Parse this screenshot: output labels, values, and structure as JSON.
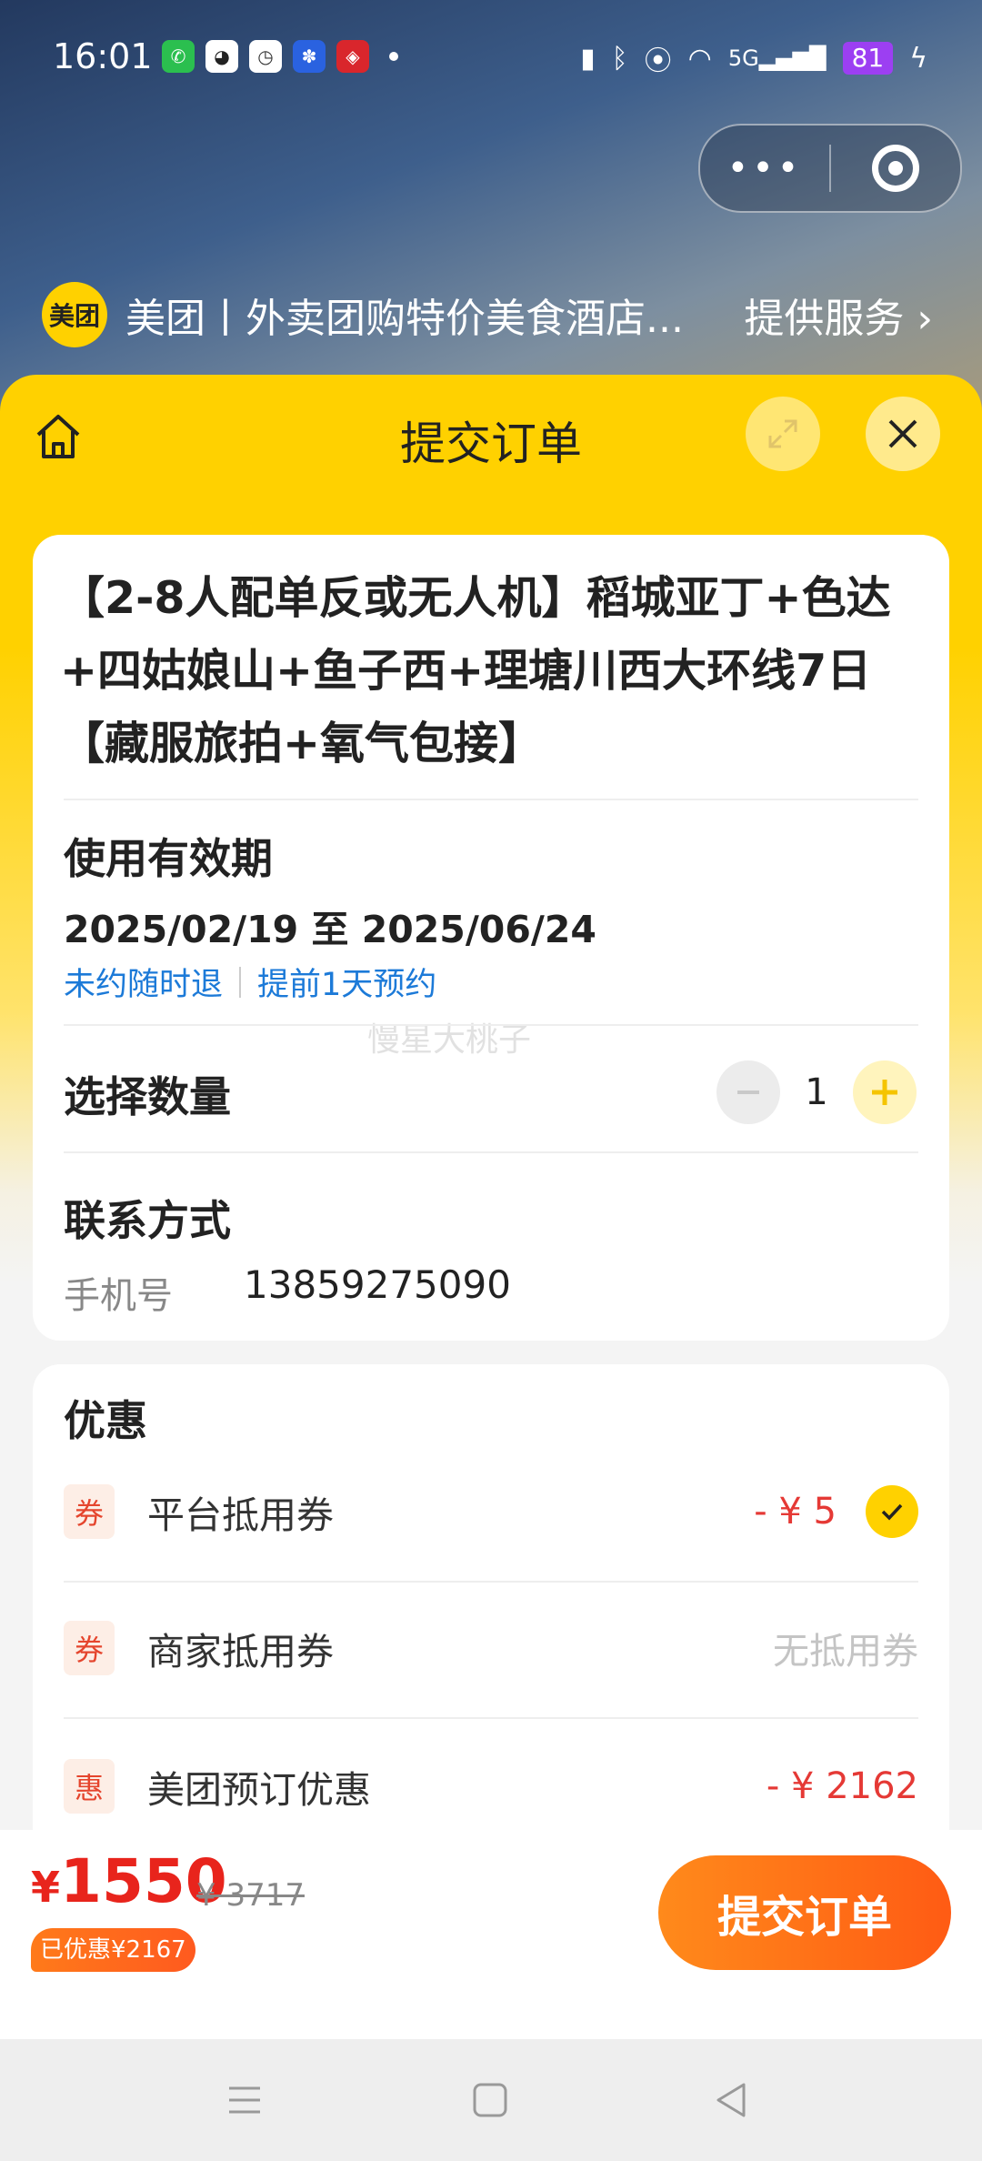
{
  "status_bar": {
    "time": "16:01",
    "battery": "81",
    "network": "5G"
  },
  "mini_program": {
    "logo_text": "美团",
    "name": "美团丨外卖团购特价美食酒店...",
    "service": "提供服务"
  },
  "header": {
    "title": "提交订单"
  },
  "product": {
    "title": "【2-8人配单反或无人机】稻城亚丁+色达+四姑娘山+鱼子西+理塘川西大环线7日【藏服旅拍+氧气包接】"
  },
  "validity": {
    "label": "使用有效期",
    "dates": "2025/02/19 至 2025/06/24",
    "tags": [
      "未约随时退",
      "提前1天预约"
    ]
  },
  "watermark": "慢星大桃子",
  "quantity": {
    "label": "选择数量",
    "value": "1"
  },
  "contact": {
    "label": "联系方式",
    "phone_label": "手机号",
    "phone": "13859275090"
  },
  "discounts": {
    "title": "优惠",
    "items": [
      {
        "badge": "券",
        "name": "平台抵用券",
        "value": "- ¥ 5",
        "checked": true
      },
      {
        "badge": "券",
        "name": "商家抵用券",
        "value": "无抵用券"
      },
      {
        "badge": "惠",
        "name": "美团预订优惠",
        "value": "- ¥ 2162"
      }
    ]
  },
  "footer": {
    "currency": "¥",
    "price": "1550",
    "original_price": "¥ 3717",
    "saved": "已优惠¥2167",
    "submit_label": "提交订单"
  },
  "colors": {
    "brand_yellow": "#ffd100",
    "price_red": "#e8241c",
    "cta_orange": "#ff6a17",
    "link_blue": "#1c7ad8"
  }
}
